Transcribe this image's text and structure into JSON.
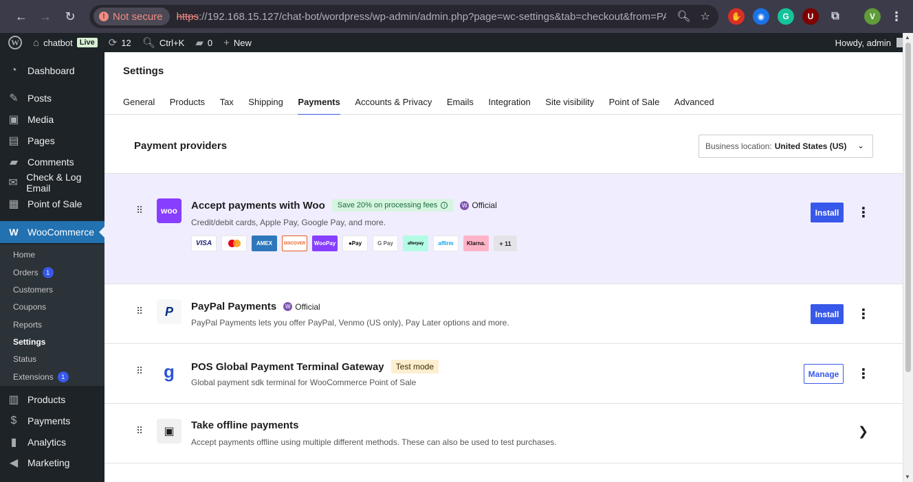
{
  "browser": {
    "not_secure": "Not secure",
    "url_scheme": "https",
    "url_rest": "://192.168.15.127/chat-bot/wordpress/wp-admin/admin.php?page=wc-settings&tab=checkout&from=PAY...",
    "profile_initial": "V"
  },
  "adminbar": {
    "site_name": "chatbot",
    "live": "Live",
    "updates": "12",
    "shortcut": "Ctrl+K",
    "comments": "0",
    "new": "New",
    "howdy": "Howdy, admin"
  },
  "sidebar": {
    "dashboard": "Dashboard",
    "posts": "Posts",
    "media": "Media",
    "pages": "Pages",
    "comments": "Comments",
    "check_log_email": "Check & Log Email",
    "point_of_sale": "Point of Sale",
    "woocommerce": "WooCommerce",
    "sub": {
      "home": "Home",
      "orders": "Orders",
      "orders_count": "1",
      "customers": "Customers",
      "coupons": "Coupons",
      "reports": "Reports",
      "settings": "Settings",
      "status": "Status",
      "extensions": "Extensions",
      "extensions_count": "1"
    },
    "products": "Products",
    "payments": "Payments",
    "analytics": "Analytics",
    "marketing": "Marketing"
  },
  "settings": {
    "title": "Settings",
    "tabs": [
      "General",
      "Products",
      "Tax",
      "Shipping",
      "Payments",
      "Accounts & Privacy",
      "Emails",
      "Integration",
      "Site visibility",
      "Point of Sale",
      "Advanced"
    ],
    "active_tab": "Payments"
  },
  "providers": {
    "title": "Payment providers",
    "location_label": "Business location:",
    "location_value": "United States (US)"
  },
  "rows": {
    "woo": {
      "logo": "woo",
      "title": "Accept payments with Woo",
      "promo": "Save 20% on processing fees",
      "official": "Official",
      "desc": "Credit/debit cards, Apple Pay, Google Pay, and more.",
      "methods": [
        "VISA",
        "",
        "AMEX",
        "DISCOVER",
        "WooPay",
        "Pay",
        "G Pay",
        "afterpay",
        "affirm",
        "Klarna.",
        "+ 11"
      ],
      "button": "Install"
    },
    "paypal": {
      "title": "PayPal Payments",
      "official": "Official",
      "desc": "PayPal Payments lets you offer PayPal, Venmo (US only), Pay Later options and more.",
      "button": "Install"
    },
    "pos": {
      "title": "POS Global Payment Terminal Gateway",
      "badge": "Test mode",
      "desc": "Global payment sdk terminal for WooCommerce Point of Sale",
      "button": "Manage"
    },
    "offline": {
      "title": "Take offline payments",
      "desc": "Accept payments offline using multiple different methods. These can also be used to test purchases."
    }
  },
  "colors": {
    "accent": "#3858e9",
    "woo_purple": "#873eff",
    "wp_dark": "#1d2327",
    "wp_blue": "#2271b1"
  }
}
